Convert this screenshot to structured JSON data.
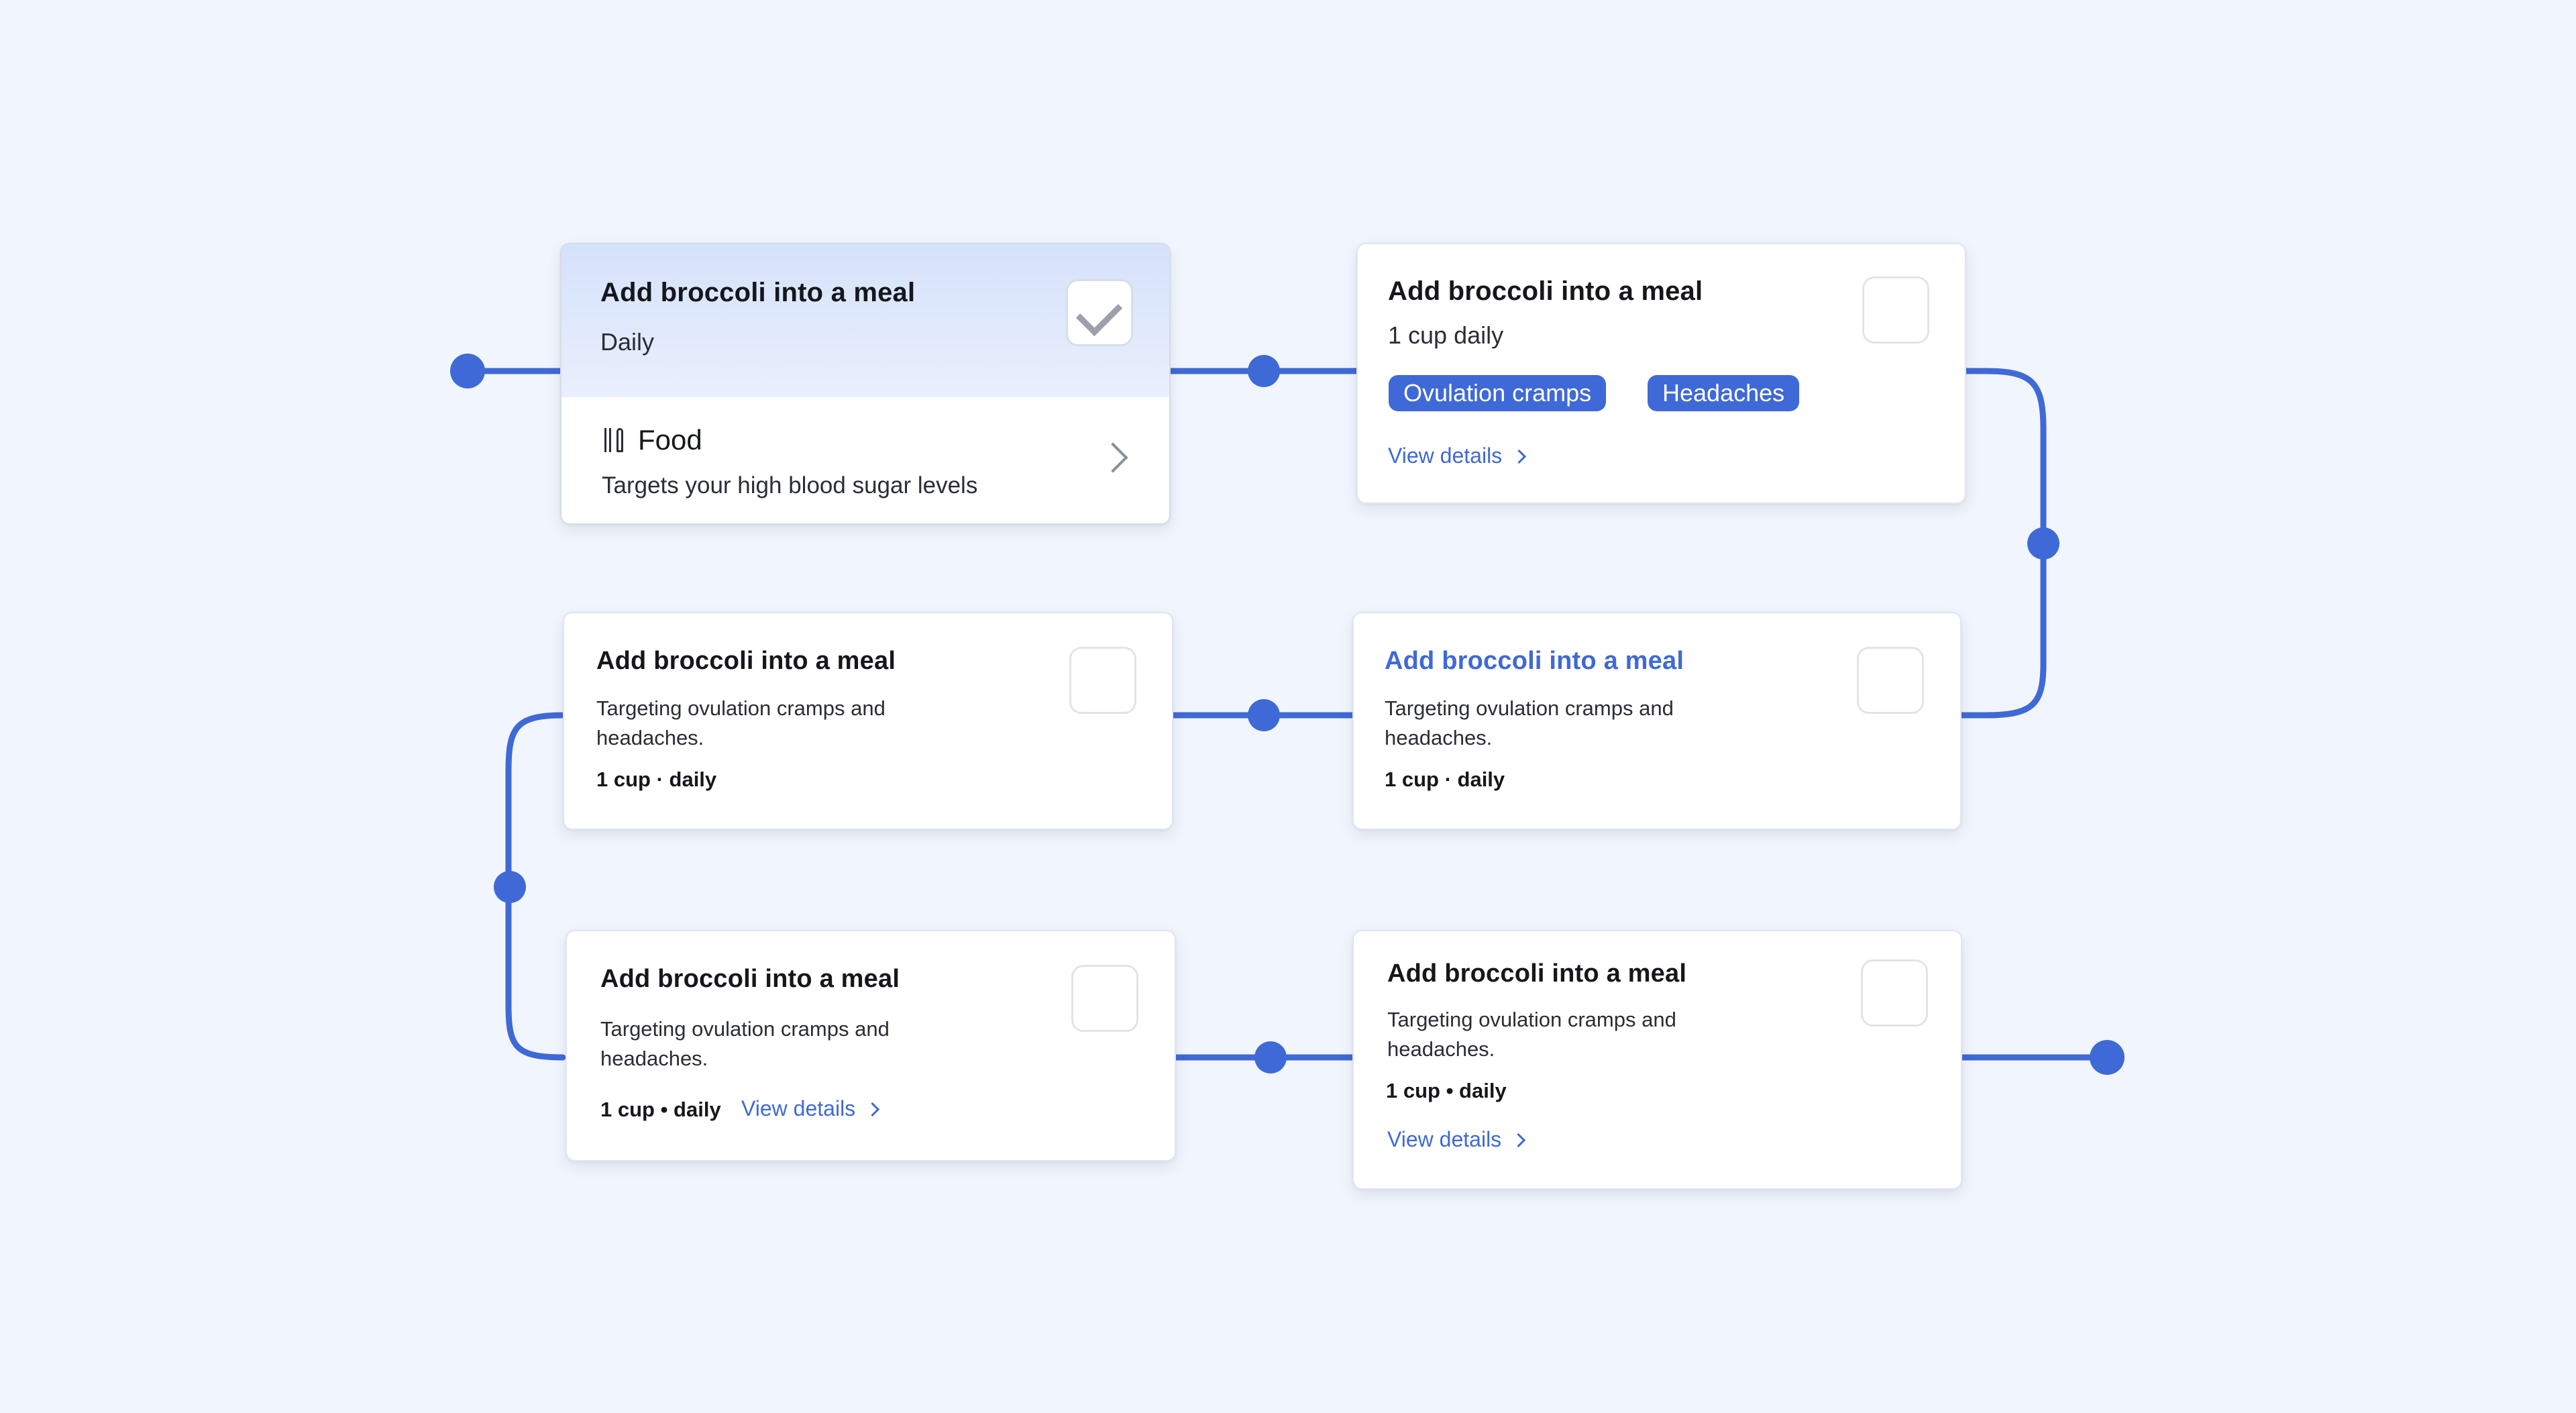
{
  "colors": {
    "background": "#f1f5fd",
    "accent": "#3f69d6",
    "card": "#ffffff"
  },
  "card1": {
    "title": "Add broccoli into a meal",
    "frequency": "Daily",
    "checked": true,
    "category_icon": "utensils-icon",
    "category": "Food",
    "description": "Targets your high blood sugar levels"
  },
  "card2": {
    "title": "Add broccoli into a meal",
    "dose": "1 cup daily",
    "tags": [
      "Ovulation cramps",
      "Headaches"
    ],
    "link": "View details"
  },
  "card3": {
    "title": "Add broccoli into a meal",
    "description": "Targeting ovulation cramps and headaches.",
    "meta": "1 cup · daily"
  },
  "card4": {
    "title": "Add broccoli into a meal",
    "description": "Targeting ovulation cramps and headaches.",
    "meta": "1 cup · daily"
  },
  "card5": {
    "title": "Add broccoli into a meal",
    "description": "Targeting ovulation cramps and headaches.",
    "meta": "1 cup • daily",
    "link": "View details"
  },
  "card6": {
    "title": "Add broccoli into a meal",
    "description": "Targeting ovulation cramps and headaches.",
    "meta": "1 cup • daily",
    "link": "View details"
  }
}
